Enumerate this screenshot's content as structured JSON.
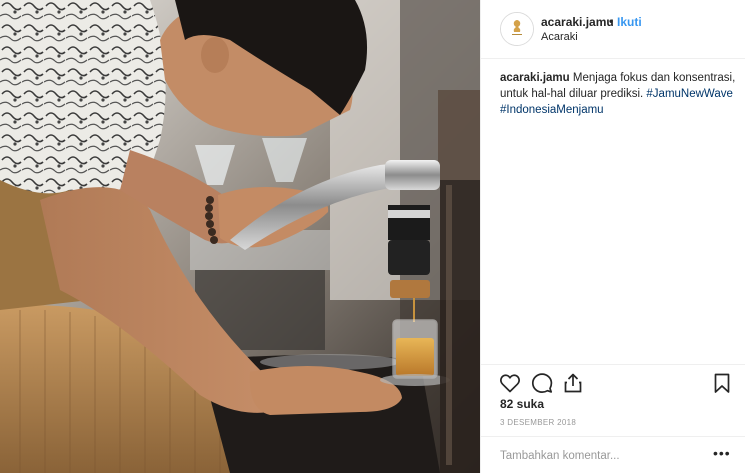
{
  "post": {
    "handle": "acaraki.jamu",
    "separator": "•",
    "follow_label": "Ikuti",
    "location": "Acaraki",
    "avatar_text": "ACARAKI"
  },
  "caption": {
    "username": "acaraki.jamu",
    "text": "Menjaga fokus dan konsentrasi, untuk hal-hal diluar prediksi.",
    "hashtags": [
      "#JamuNewWave",
      "#IndonesiaMenjamu"
    ]
  },
  "actions": {
    "like_icon": "heart-icon",
    "comment_icon": "comment-icon",
    "share_icon": "share-icon",
    "save_icon": "bookmark-icon"
  },
  "stats": {
    "likes": "82 suka",
    "date": "3 DESEMBER 2018"
  },
  "comment": {
    "placeholder": "Tambahkan komentar...",
    "more_label": "•••"
  },
  "colors": {
    "link_blue": "#3897f0",
    "hashtag": "#003569",
    "muted": "#999999",
    "divider": "#efefef"
  }
}
